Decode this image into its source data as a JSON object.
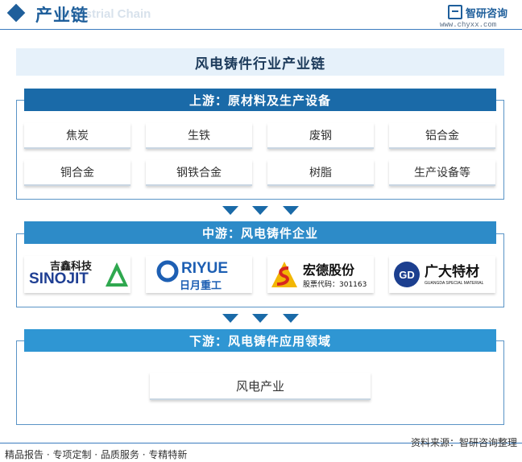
{
  "header": {
    "title": "产业链",
    "subtitle": "Industrial Chain",
    "brand_name": "智研咨询",
    "brand_url": "www.chyxx.com"
  },
  "main_title": "风电铸件行业产业链",
  "upstream": {
    "label": "上游：原材料及生产设备",
    "items": [
      "焦炭",
      "生铁",
      "废钢",
      "铝合金",
      "铜合金",
      "钢铁合金",
      "树脂",
      "生产设备等"
    ]
  },
  "midstream": {
    "label": "中游：风电铸件企业",
    "companies": [
      {
        "name_cn": "吉鑫科技",
        "name_en": "SINOJIT",
        "icon": "triangle-logo-icon"
      },
      {
        "name_cn": "日月重工",
        "name_en": "RIYUE",
        "icon": "ring-logo-icon"
      },
      {
        "name_cn": "宏德股份",
        "stock_label": "股票代码：301163",
        "icon": "s-mountain-logo-icon"
      },
      {
        "name_cn": "广大特材",
        "name_en": "GUANGDA SPECIAL MATERIAL",
        "icon": "gd-circle-logo-icon"
      }
    ]
  },
  "downstream": {
    "label": "下游：风电铸件应用领域",
    "items": [
      "风电产业"
    ]
  },
  "footer": {
    "tags": "精品报告 · 专项定制 · 品质服务 · 专精特新",
    "source": "资料来源：智研咨询整理"
  },
  "colors": {
    "upstream_band": "#1a6aa8",
    "midstream_band": "#2d8bc8",
    "downstream_band": "#2f96d3",
    "accent": "#1f5f9b"
  }
}
